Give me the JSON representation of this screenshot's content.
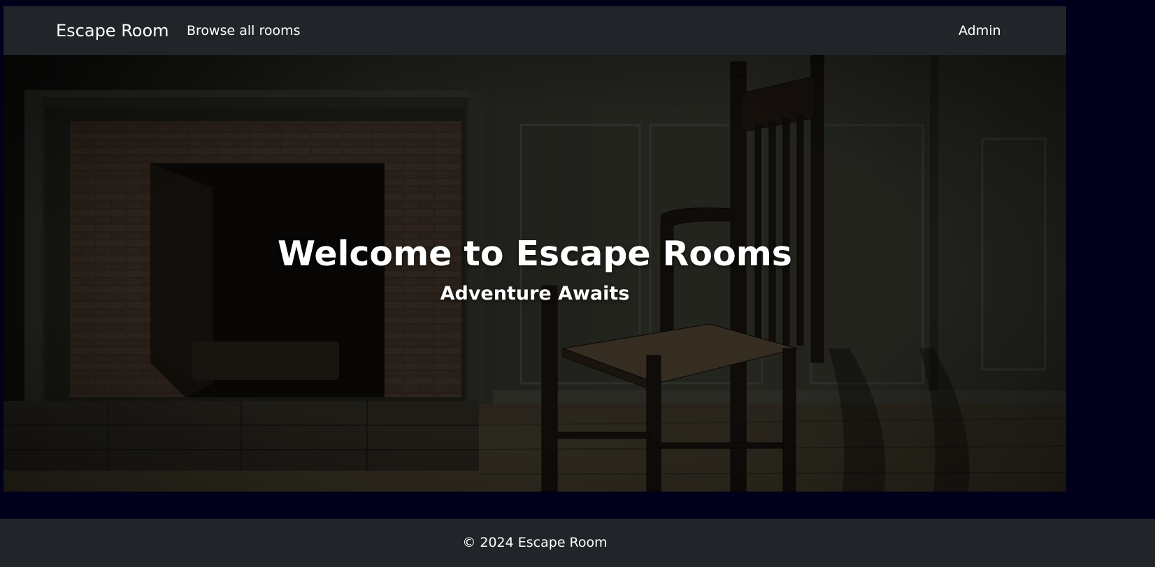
{
  "navbar": {
    "brand": "Escape Room",
    "browse_link": "Browse all rooms",
    "admin_link": "Admin"
  },
  "hero": {
    "title": "Welcome to Escape Rooms",
    "subtitle": "Adventure Awaits",
    "image": "haunted-room-fireplace-chair"
  },
  "footer": {
    "copyright": "© 2024 Escape Room"
  },
  "colors": {
    "page_background": "#00001a",
    "navbar_background": "#212529",
    "footer_background": "#212529",
    "text": "#ffffff"
  }
}
